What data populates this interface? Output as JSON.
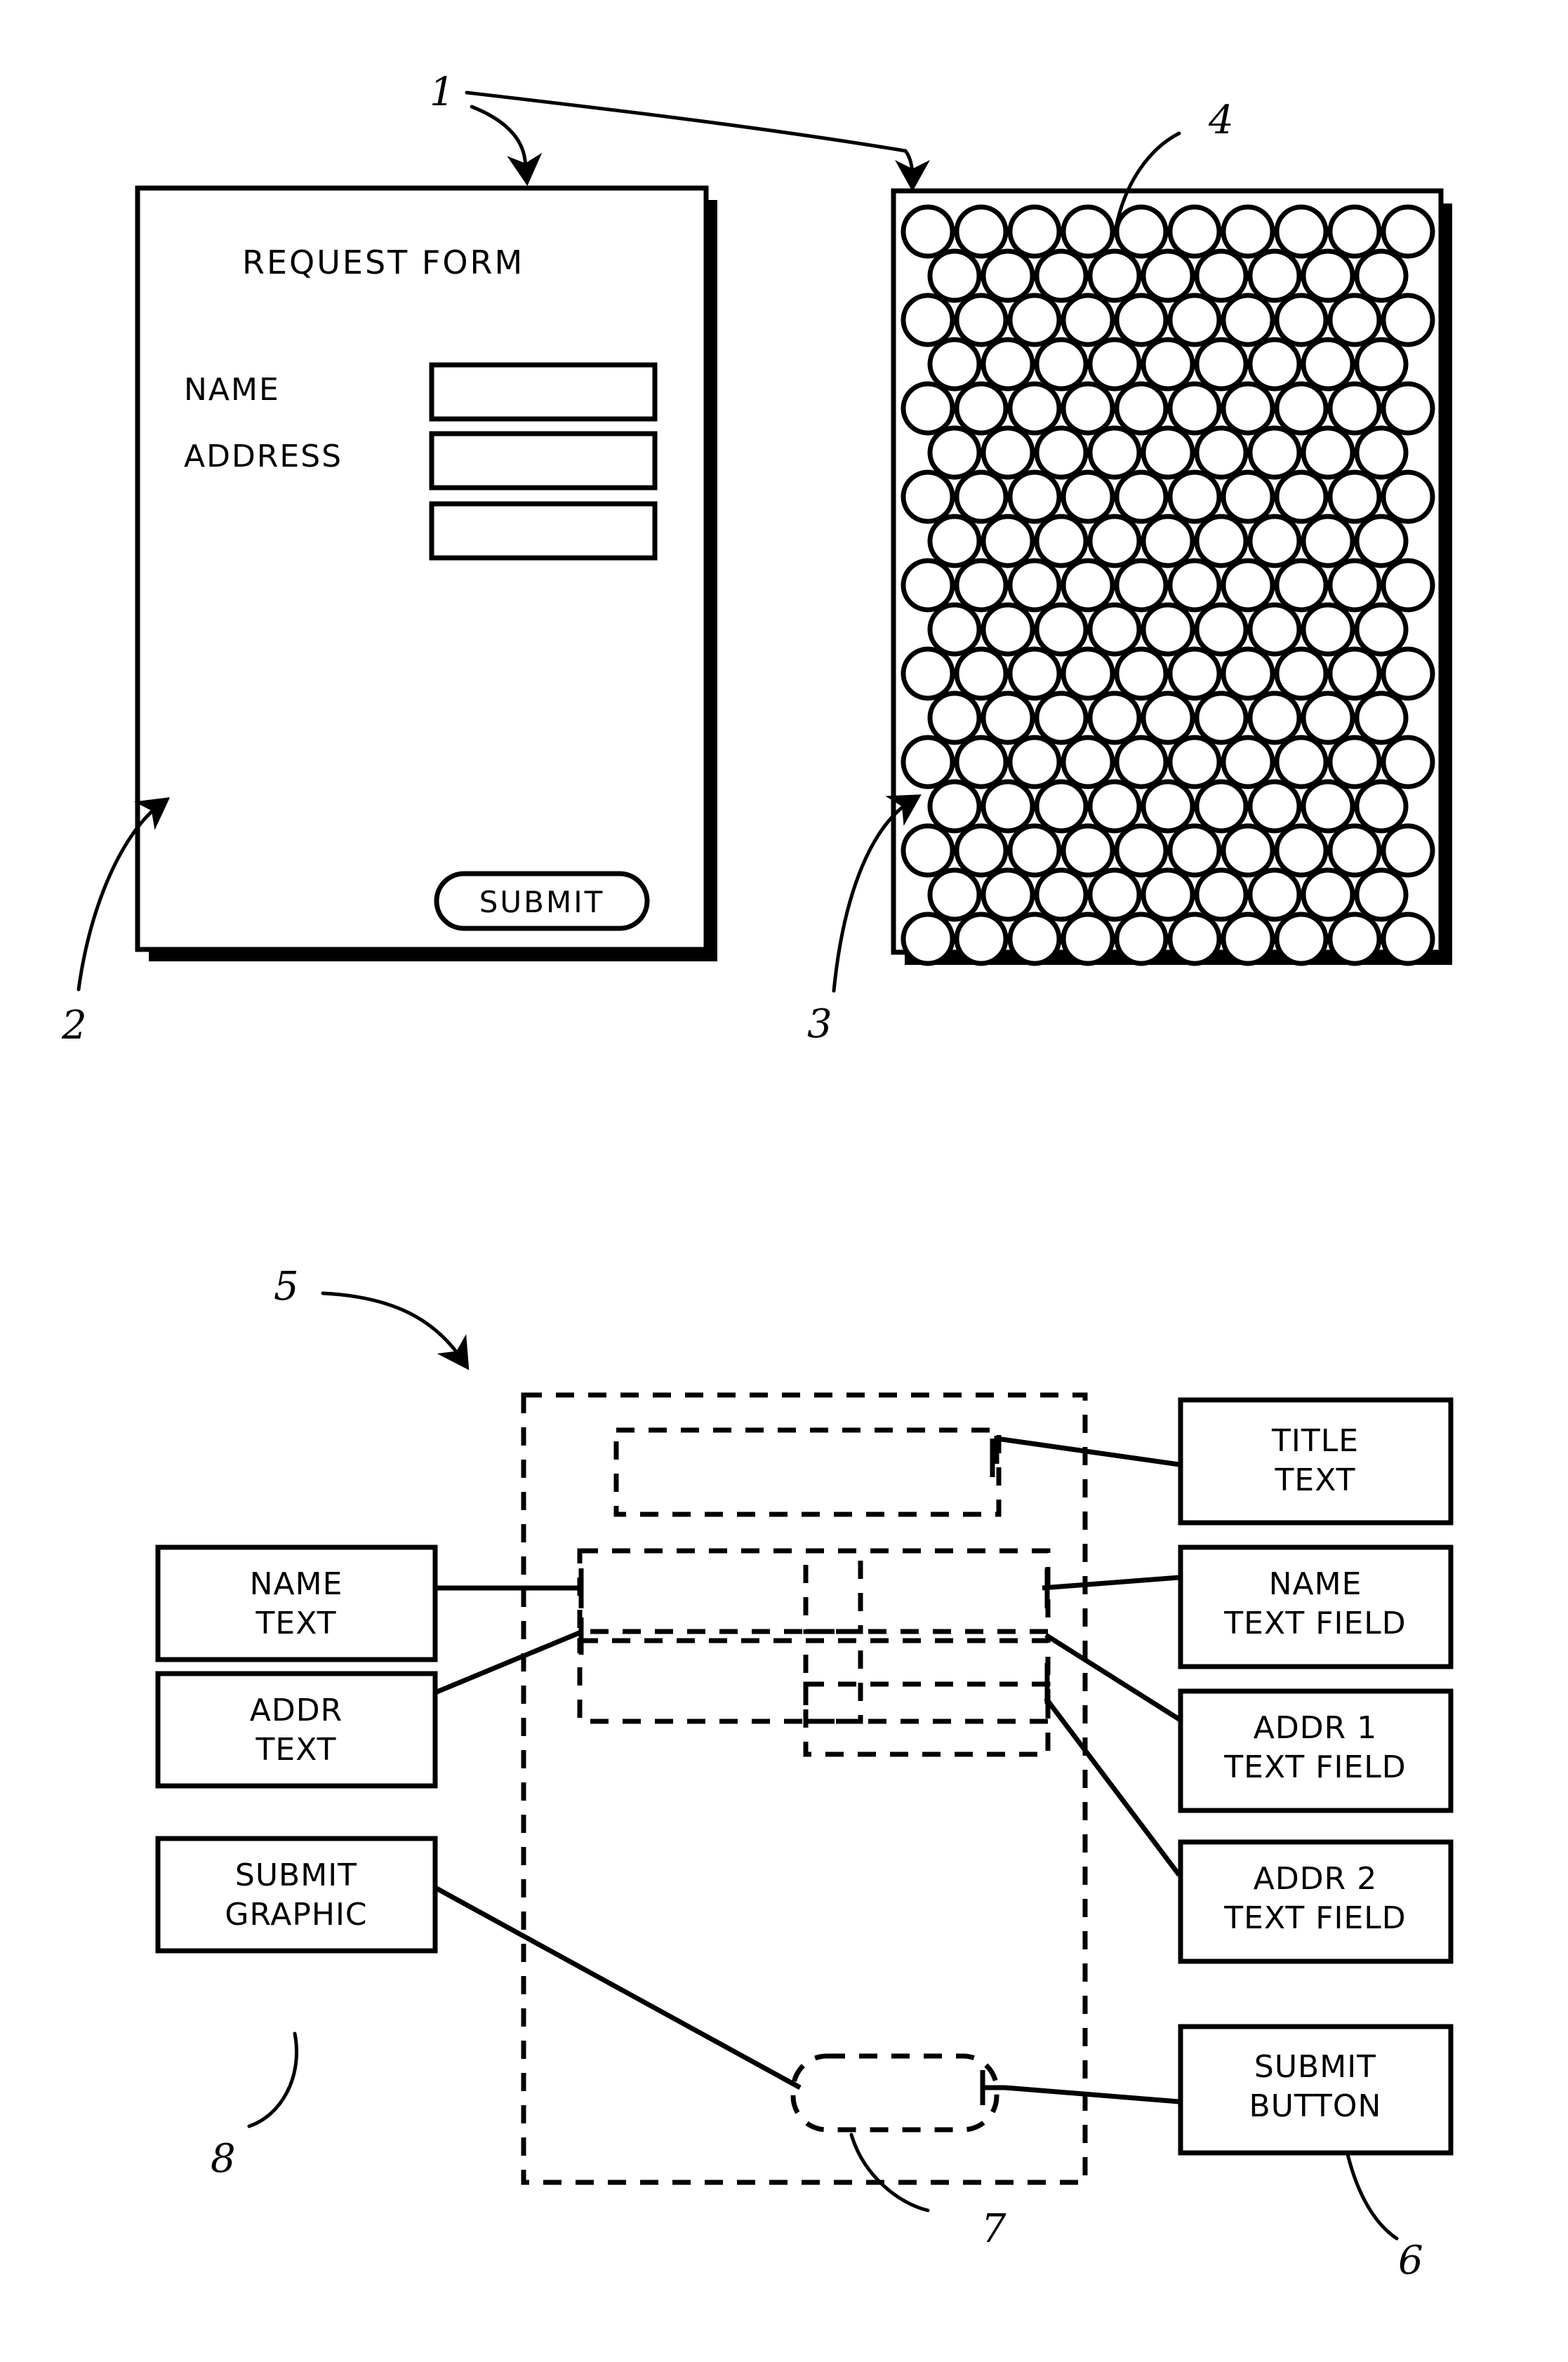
{
  "figure": {
    "kind": "patent-diagram",
    "colors": {
      "ink": "#000000",
      "paper": "#ffffff"
    }
  },
  "visual_form": {
    "name": "request-form-document",
    "title": "REQUEST FORM",
    "labels": [
      "NAME",
      "ADDRESS"
    ],
    "field_count": 3,
    "submit_label": "SUBMIT",
    "reference_numeral": "2",
    "callout_numeral": "1"
  },
  "braille_form": {
    "name": "braille-tactile-form",
    "reference_numeral": "3",
    "dot_numeral": "4",
    "dot_rows": 17,
    "dot_cols": 10
  },
  "block_diagram": {
    "reference_numeral": "5",
    "left_boxes": [
      {
        "id": "name-text",
        "line1": "NAME",
        "line2": "TEXT"
      },
      {
        "id": "addr-text",
        "line1": "ADDR",
        "line2": "TEXT"
      },
      {
        "id": "submit-graphic",
        "line1": "SUBMIT",
        "line2": "GRAPHIC",
        "numeral": "8"
      }
    ],
    "right_boxes": [
      {
        "id": "title-text",
        "line1": "TITLE",
        "line2": "TEXT"
      },
      {
        "id": "name-text-field",
        "line1": "NAME",
        "line2": "TEXT FIELD"
      },
      {
        "id": "addr1-text-field",
        "line1": "ADDR 1",
        "line2": "TEXT FIELD"
      },
      {
        "id": "addr2-text-field",
        "line1": "ADDR 2",
        "line2": "TEXT FIELD"
      },
      {
        "id": "submit-button",
        "line1": "SUBMIT",
        "line2": "BUTTON",
        "numeral": "6"
      }
    ],
    "dashed_regions": [
      {
        "id": "outer-container",
        "numeral": null
      },
      {
        "id": "title-region",
        "numeral": null
      },
      {
        "id": "name-row-region",
        "numeral": null
      },
      {
        "id": "addr-row-region",
        "numeral": null
      },
      {
        "id": "submit-region",
        "numeral": "7"
      }
    ]
  },
  "numerals": [
    "1",
    "2",
    "3",
    "4",
    "5",
    "6",
    "7",
    "8"
  ]
}
